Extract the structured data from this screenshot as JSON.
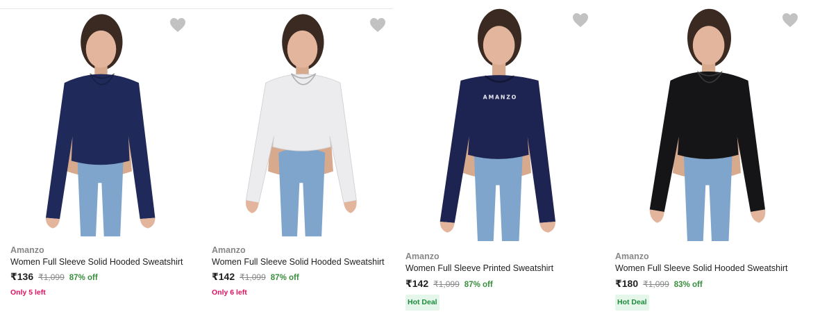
{
  "colors": {
    "brand": "#878787",
    "title": "#212121",
    "discount": "#388e3c",
    "stock_warning": "#e0115f",
    "badge_text": "#1e8b3c",
    "badge_bg": "#e5f7ea",
    "heart": "#c2c2c2"
  },
  "products": [
    {
      "brand": "Amanzo",
      "title": "Women Full Sleeve Solid Hooded Sweatshirt",
      "price": "₹136",
      "mrp": "₹1,099",
      "discount": "87% off",
      "stock_note": "Only 5 left",
      "badge": "",
      "image": {
        "description": "woman in navy cropped hooded sweatshirt and blue jeans",
        "top_color": "#1f2a5a",
        "hood": true,
        "print": ""
      },
      "wishlist_icon": "heart-icon"
    },
    {
      "brand": "Amanzo",
      "title": "Women Full Sleeve Solid Hooded Sweatshirt",
      "price": "₹142",
      "mrp": "₹1,099",
      "discount": "87% off",
      "stock_note": "Only 6 left",
      "badge": "",
      "image": {
        "description": "woman in white cropped hooded sweatshirt and blue jeans",
        "top_color": "#ececee",
        "hood": true,
        "print": ""
      },
      "wishlist_icon": "heart-icon"
    },
    {
      "brand": "Amanzo",
      "title": "Women Full Sleeve Printed Sweatshirt",
      "price": "₹142",
      "mrp": "₹1,099",
      "discount": "87% off",
      "stock_note": "",
      "badge": "Hot Deal",
      "image": {
        "description": "woman in navy cropped printed sweatshirt and blue jeans",
        "top_color": "#1d2451",
        "hood": false,
        "print": "AMANZO"
      },
      "wishlist_icon": "heart-icon"
    },
    {
      "brand": "Amanzo",
      "title": "Women Full Sleeve Solid Hooded Sweatshirt",
      "price": "₹180",
      "mrp": "₹1,099",
      "discount": "83% off",
      "stock_note": "",
      "badge": "Hot Deal",
      "image": {
        "description": "woman in black cropped hooded sweatshirt and blue jeans",
        "top_color": "#151518",
        "hood": true,
        "print": ""
      },
      "wishlist_icon": "heart-icon"
    }
  ]
}
